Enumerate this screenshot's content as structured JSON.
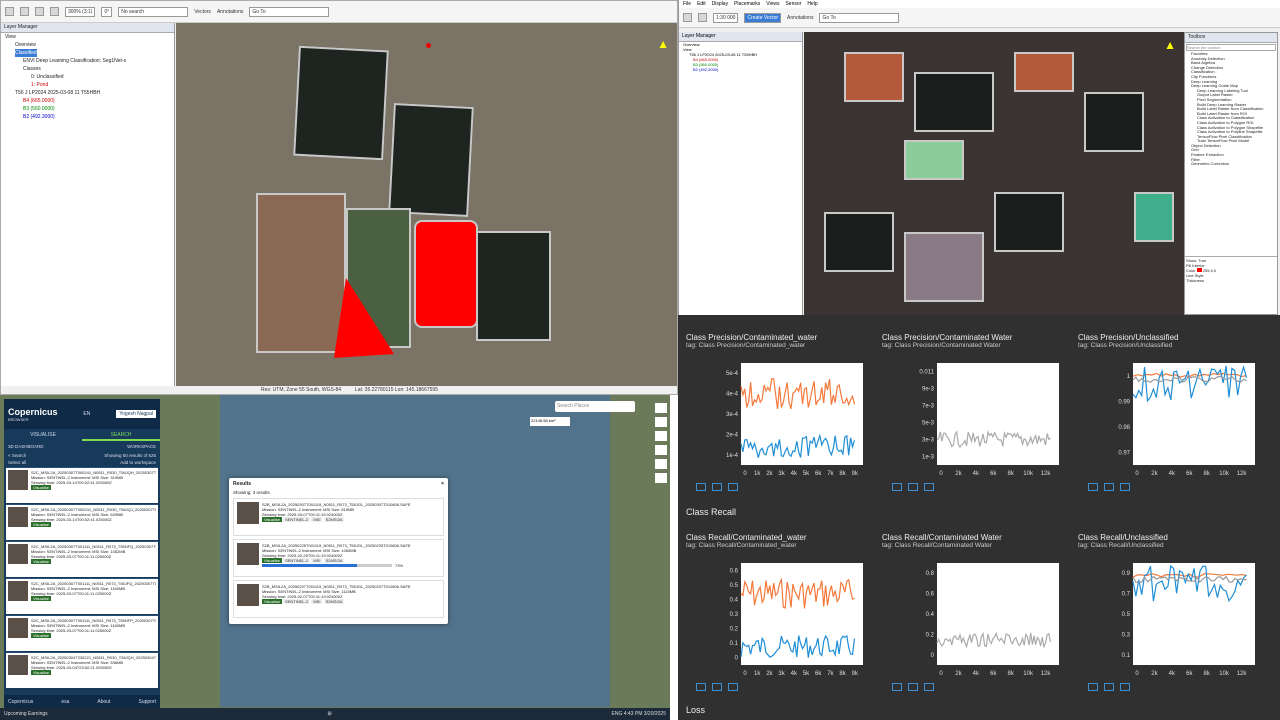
{
  "envi_left": {
    "zoom": "300% (3:1)",
    "rotation": "0°",
    "search_placeholder": "No search",
    "vectors_label": "Vectors",
    "annotations_label": "Annotations",
    "goto_label": "Go To",
    "layer_manager_title": "Layer Manager",
    "layers": [
      "View",
      "Overview",
      "Classified",
      "ENVI Deep Learning Classification: Seg1Net-x",
      "Classes",
      "0: Unclassified",
      "1: Pond",
      "T56 J LP2024 2025-03-08 11 T55HBH",
      "B4 (665.0000)",
      "B3 (560.0000)",
      "B2 (492.3000)"
    ],
    "status_left": "Res: UTM, Zone 55 South, WGS-84",
    "status_mid": "Lat: 35.22780115  Lon: 145.18667595"
  },
  "envi_right": {
    "menu": [
      "File",
      "Edit",
      "Display",
      "Placemarks",
      "Views",
      "Sensor",
      "Help"
    ],
    "zoom": "1:30 000",
    "display_mode": "Create Vector",
    "annotations_label": "Annotations",
    "goto_label": "Go To",
    "layer_manager_title": "Layer Manager",
    "layers": [
      "Overview",
      "View",
      "T56 J LP2024 2025-03-08 11 T55HBH",
      "B4 (665.0000)",
      "B3 (560.0000)",
      "B2 (492.3000)"
    ],
    "toolbox_title": "Toolbox",
    "toolbox_search": "Search the toolbox",
    "toolbox_items": [
      "Favorites",
      "Anomaly Detection",
      "Band Algebra",
      "Change Detection",
      "Classification",
      "Clip Functions",
      "Deep Learning",
      "Deep Learning Guide Map",
      "Deep Learning Labeling Tool",
      "Output Label Raster",
      "Pixel Segmentation",
      "Build Deep Learning Raster",
      "Build Label Raster from Classification",
      "Build Label Raster from ROI",
      "Class Activation to Classification",
      "Class Activation to Polygon ROI",
      "Class Activation to Polygon Shapefile",
      "Class Activation to Polyline Shapefile",
      "TensorFlow Pixel Classification",
      "Train TensorFlow Pixel Model",
      "Object Detection",
      "Grid",
      "Feature Extraction",
      "Filter",
      "Geometric Correction"
    ],
    "props": [
      "Show",
      "True",
      "Fill Interior",
      "Color",
      "255,0,0",
      "Line Style",
      "Thickness"
    ]
  },
  "copernicus": {
    "brand": "Copernicus",
    "brand_sub": "BROWSER",
    "lang": "EN",
    "user": "Yogesh Nagpal",
    "tab_visualise": "VISUALISE",
    "tab_search": "SEARCH",
    "dashboard_btn": "3D DASHBOARD",
    "workspace_btn": "WORKSPACE",
    "search_back": "< Search",
    "showing": "Showing 50 results of 625",
    "select_all": "Select all",
    "add_to_workspace": "Add to workspace",
    "results": [
      {
        "name": "S2C_MSIL2A_20250307T000241_N0511_R030_T56JQH_20250307T035733.SAFE",
        "mission": "SENTINEL-2",
        "instrument": "MSI",
        "size": "319MB",
        "sensing": "2025-03-14T00:02:41.025000Z"
      },
      {
        "name": "S2C_MSIL2A_20250307T000241_N0511_R030_T56JQJ_20250307T035733.SAFE",
        "mission": "SENTINEL-2",
        "instrument": "MSI",
        "size": "629MB",
        "sensing": "2025-03-14T00:02:41.025000Z"
      },
      {
        "name": "S2C_MSIL2A_20250307T001111_N0511_R073_T55HFQ_20250307T035733.SAFE",
        "mission": "SENTINEL-2",
        "instrument": "MSI",
        "size": "1082MB",
        "sensing": "2025-03-07T00:11:11.025000Z"
      },
      {
        "name": "S2C_MSIL2A_20250307T001111_N0511_R073_T55JFQ_20250307T035733.SAFE",
        "mission": "SENTINEL-2",
        "instrument": "MSI",
        "size": "1160MB",
        "sensing": "2025-03-07T00:11:11.025000Z"
      },
      {
        "name": "S2C_MSIL2A_20250307T001111_N0511_R073_T55HFP_20250307T035733.SAFE",
        "mission": "SENTINEL-2",
        "instrument": "MSI",
        "size": "1160MB",
        "sensing": "2025-03-07T00:11:11.025000Z"
      },
      {
        "name": "S2C_MSIL2A_20250304T235221_N0511_R030_T56JQH_20250304T035733.SAFE",
        "mission": "SENTINEL-2",
        "instrument": "MSI",
        "size": "536MB",
        "sensing": "2025-03-04T23:52:21.025000Z"
      }
    ],
    "dialog_title": "Results",
    "dialog_showing": "Showing: 3 results",
    "dialog_items": [
      {
        "name": "S2B_MSIL2A_20250307T001119_N0511_R073_T55JGL_20250307T010606.SAFE",
        "mission": "SENTINEL-2",
        "instrument": "MSI",
        "size": "815MB",
        "sensing": "2025-03-07T00:11:19.024000Z",
        "tags": [
          "SENTINEL-2",
          "MSI",
          "S2MSI2A"
        ]
      },
      {
        "name": "S2B_MSIL2A_20250225T001119_N0511_R073_T55JGL_20250225T010606.SAFE",
        "mission": "SENTINEL-2",
        "instrument": "MSI",
        "size": "1065MB",
        "sensing": "2025-02-25T00:11:19.024000Z",
        "tags": [
          "SENTINEL-2",
          "MSI",
          "S2MSI2A"
        ],
        "progress": "73%"
      },
      {
        "name": "S2B_MSIL2A_20250207T001119_N0511_R073_T55JGL_20250207T010606.SAFE",
        "mission": "SENTINEL-2",
        "instrument": "MSI",
        "size": "1115MB",
        "sensing": "2025-02-07T00:11:19.024000Z",
        "tags": [
          "SENTINEL-2",
          "MSI",
          "S2MSI2A"
        ]
      }
    ],
    "progress_fraction": 0.73,
    "visualise_btn": "Visualise",
    "date_field": "Search Places",
    "scale": "22145.58 km²",
    "weather": "Upcoming Earnings",
    "clock_time": "4:43 PM",
    "clock_date": "3/20/2025",
    "footer_about": "About",
    "footer_support": "Support",
    "esa": "esa",
    "lang_bar": "ENG"
  },
  "tensorboard": {
    "precision_cards": [
      {
        "title": "Class Precision/Contaminated_water",
        "tag": "tag: Class Precision/Contaminated_water",
        "yticks": [
          "5e-4",
          "4e-4",
          "3e-4",
          "2e-4",
          "1e-4"
        ],
        "xticks": [
          "0",
          "1k",
          "2k",
          "3k",
          "4k",
          "5k",
          "6k",
          "7k",
          "8k",
          "9k"
        ]
      },
      {
        "title": "Class Precision/Contaminated Water",
        "tag": "tag: Class Precision/Contaminated Water",
        "yticks": [
          "0.011",
          "9e-3",
          "7e-3",
          "5e-3",
          "3e-3",
          "1e-3"
        ],
        "xticks": [
          "0",
          "2k",
          "4k",
          "6k",
          "8k",
          "10k",
          "12k"
        ]
      },
      {
        "title": "Class Precision/Unclassified",
        "tag": "tag: Class Precision/Unclassified",
        "yticks": [
          "1",
          "0.99",
          "0.98",
          "0.97"
        ],
        "xticks": [
          "0",
          "2k",
          "4k",
          "6k",
          "8k",
          "10k",
          "12k"
        ]
      }
    ],
    "recall_section": "Class Recall",
    "recall_cards": [
      {
        "title": "Class Recall/Contaminated_water",
        "tag": "tag: Class Recall/Contaminated_water",
        "yticks": [
          "0.6",
          "0.5",
          "0.4",
          "0.3",
          "0.2",
          "0.1",
          "0"
        ],
        "xticks": [
          "0",
          "1k",
          "2k",
          "3k",
          "4k",
          "5k",
          "6k",
          "7k",
          "8k",
          "9k"
        ]
      },
      {
        "title": "Class Recall/Contaminated Water",
        "tag": "tag: Class Recall/Contaminated Water",
        "yticks": [
          "0.8",
          "0.6",
          "0.4",
          "0.2",
          "0"
        ],
        "xticks": [
          "0",
          "2k",
          "4k",
          "6k",
          "8k",
          "10k",
          "12k"
        ]
      },
      {
        "title": "Class Recall/Unclassified",
        "tag": "tag: Class Recall/Unclassified",
        "yticks": [
          "0.9",
          "0.7",
          "0.5",
          "0.3",
          "0.1"
        ],
        "xticks": [
          "0",
          "2k",
          "4k",
          "6k",
          "8k",
          "10k",
          "12k"
        ]
      }
    ],
    "loss_section": "Loss",
    "colors": {
      "orange": "#f4793b",
      "blue": "#1f8ed6",
      "white": "#d9d9d9"
    }
  }
}
